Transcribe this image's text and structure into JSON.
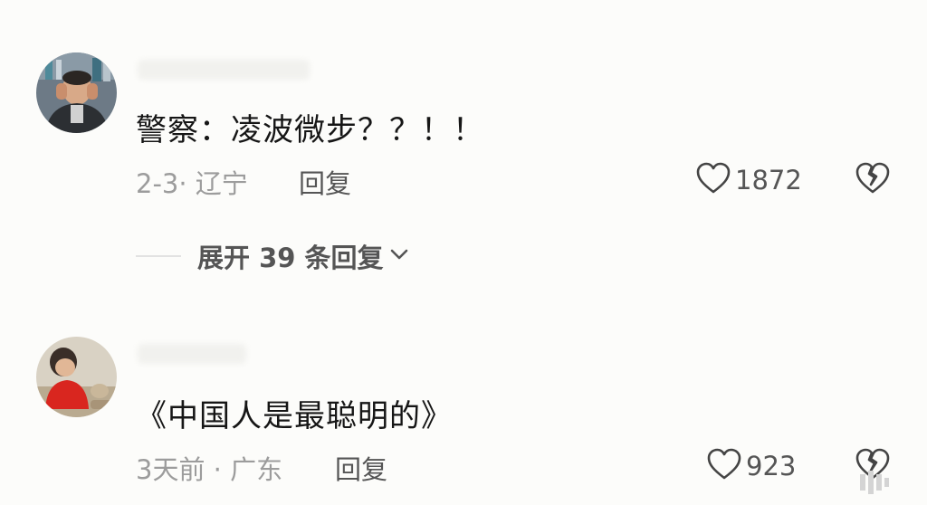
{
  "comments": [
    {
      "content": "警察：凌波微步？？！！",
      "meta": "2-3· 辽宁",
      "reply_label": "回复",
      "like_count": "1872",
      "username": ""
    },
    {
      "content": "《中国人是最聪明的》",
      "meta": "3天前 · 广东",
      "reply_label": "回复",
      "like_count": "923",
      "username": ""
    }
  ],
  "expand_replies": {
    "label": "展开 39 条回复"
  },
  "icons": {
    "like": "heart-outline-icon",
    "dislike": "broken-heart-icon",
    "expand": "chevron-down-icon"
  },
  "colors": {
    "background": "#fcfcfa",
    "text_primary": "#161616",
    "text_secondary": "#9c9c9c",
    "action": "#555555"
  }
}
